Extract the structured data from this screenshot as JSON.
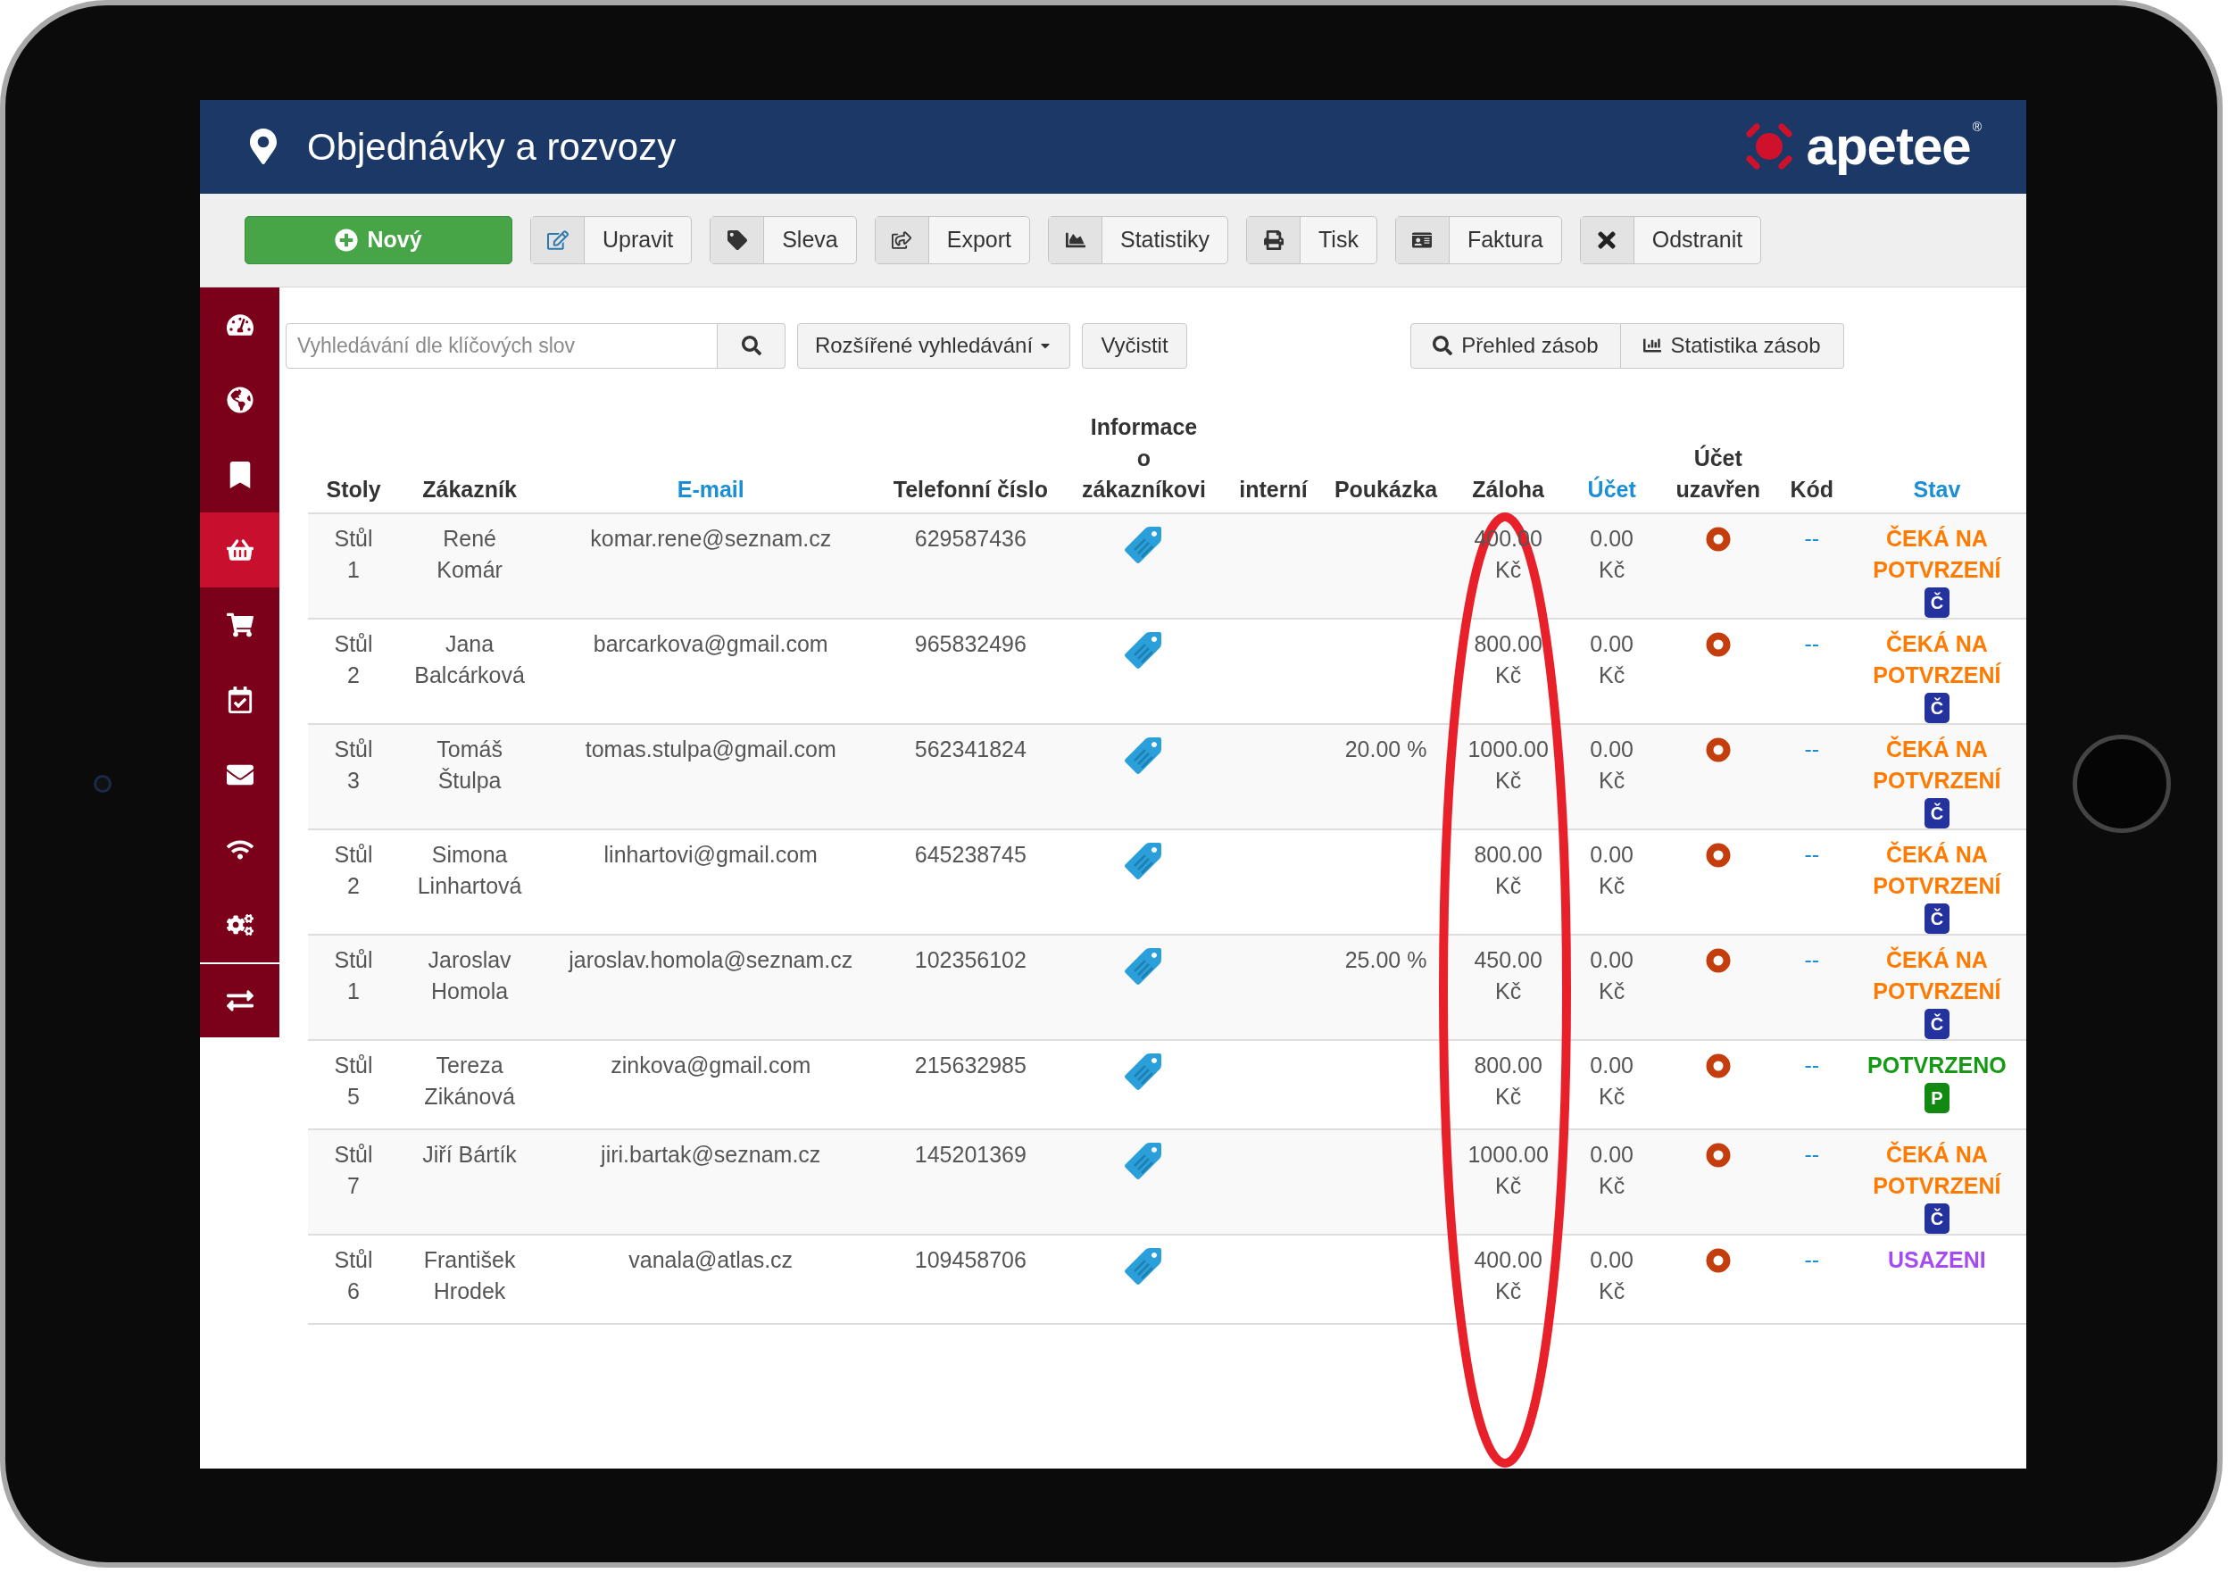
{
  "header": {
    "title": "Objednávky a rozvozy",
    "logo": "apetee",
    "logo_mark": "®"
  },
  "toolbar": [
    {
      "label": "Nový",
      "kind": "primary"
    },
    {
      "label": "Upravit",
      "kind": "default"
    },
    {
      "label": "Sleva",
      "kind": "default"
    },
    {
      "label": "Export",
      "kind": "default"
    },
    {
      "label": "Statistiky",
      "kind": "default"
    },
    {
      "label": "Tisk",
      "kind": "default"
    },
    {
      "label": "Faktura",
      "kind": "default"
    },
    {
      "label": "Odstranit",
      "kind": "default"
    }
  ],
  "sidebar": {
    "items": [
      {
        "selected": false
      },
      {
        "selected": false
      },
      {
        "selected": false
      },
      {
        "selected": true
      },
      {
        "selected": false
      },
      {
        "selected": false
      },
      {
        "selected": false
      },
      {
        "selected": false
      },
      {
        "selected": false
      },
      {
        "selected": false
      }
    ]
  },
  "search": {
    "placeholder": "Vyhledávání dle klíčových slov",
    "advanced": "Rozšířené vyhledávání",
    "clear": "Vyčistit",
    "stock_buttons": [
      "Přehled zásob",
      "Statistika zásob"
    ]
  },
  "table": {
    "columns": [
      {
        "label": "Stoly",
        "sortable": false
      },
      {
        "label": "Zákazník",
        "sortable": false
      },
      {
        "label": "E-mail",
        "sortable": true
      },
      {
        "label": "Telefonní číslo",
        "sortable": false
      },
      {
        "label": "Informace\no\nzákazníkovi",
        "sortable": false
      },
      {
        "label": "interní",
        "sortable": false
      },
      {
        "label": "Poukázka",
        "sortable": false
      },
      {
        "label": "Záloha",
        "sortable": false
      },
      {
        "label": "Účet",
        "sortable": true
      },
      {
        "label": "Účet\nuzavřen",
        "sortable": false
      },
      {
        "label": "Kód",
        "sortable": false
      },
      {
        "label": "Stav",
        "sortable": true
      }
    ],
    "rows": [
      {
        "table": "Stůl 1",
        "customer": "René\nKomár",
        "email": "komar.rene@seznam.cz",
        "phone": "629587436",
        "deposit": "400.00 Kč",
        "account": "0.00 Kč",
        "code": "--",
        "status": {
          "label": "ČEKÁ NA POTVRZENÍ",
          "kind": "pending"
        },
        "badge": {
          "label": "Č",
          "kind": "pending"
        }
      },
      {
        "table": "Stůl 2",
        "customer": "Jana\nBalcárková",
        "email": "barcarkova@gmail.com",
        "phone": "965832496",
        "deposit": "800.00 Kč",
        "account": "0.00 Kč",
        "code": "--",
        "status": {
          "label": "ČEKÁ NA POTVRZENÍ",
          "kind": "pending"
        },
        "badge": {
          "label": "Č",
          "kind": "pending"
        }
      },
      {
        "table": "Stůl 3",
        "customer": "Tomáš\nŠtulpa",
        "email": "tomas.stulpa@gmail.com",
        "phone": "562341824",
        "voucher": "20.00 %",
        "deposit": "1000.00 Kč",
        "account": "0.00 Kč",
        "code": "--",
        "status": {
          "label": "ČEKÁ NA POTVRZENÍ",
          "kind": "pending"
        },
        "badge": {
          "label": "Č",
          "kind": "pending"
        }
      },
      {
        "table": "Stůl 2",
        "customer": "Simona\nLinhartová",
        "email": "linhartovi@gmail.com",
        "phone": "645238745",
        "deposit": "800.00 Kč",
        "account": "0.00 Kč",
        "code": "--",
        "status": {
          "label": "ČEKÁ NA POTVRZENÍ",
          "kind": "pending"
        },
        "badge": {
          "label": "Č",
          "kind": "pending"
        }
      },
      {
        "table": "Stůl 1",
        "customer": "Jaroslav\nHomola",
        "email": "jaroslav.homola@seznam.cz",
        "phone": "102356102",
        "voucher": "25.00 %",
        "deposit": "450.00 Kč",
        "account": "0.00 Kč",
        "code": "--",
        "status": {
          "label": "ČEKÁ NA POTVRZENÍ",
          "kind": "pending"
        },
        "badge": {
          "label": "Č",
          "kind": "pending"
        }
      },
      {
        "table": "Stůl 5",
        "customer": "Tereza\nZikánová",
        "email": "zinkova@gmail.com",
        "phone": "215632985",
        "deposit": "800.00 Kč",
        "account": "0.00 Kč",
        "code": "--",
        "status": {
          "label": "POTVRZENO",
          "kind": "confirmed"
        },
        "badge": {
          "label": "P",
          "kind": "confirmed"
        }
      },
      {
        "table": "Stůl 7",
        "customer": "Jiří Bártík",
        "email": "jiri.bartak@seznam.cz",
        "phone": "145201369",
        "deposit": "1000.00 Kč",
        "account": "0.00 Kč",
        "code": "--",
        "status": {
          "label": "ČEKÁ NA POTVRZENÍ",
          "kind": "pending"
        },
        "badge": {
          "label": "Č",
          "kind": "pending"
        }
      },
      {
        "table": "Stůl 6",
        "customer": "František\nHrodek",
        "email": "vanala@atlas.cz",
        "phone": "109458706",
        "deposit": "400.00 Kč",
        "account": "0.00 Kč",
        "code": "--",
        "status": {
          "label": "USAZENI",
          "kind": "seated"
        }
      }
    ]
  }
}
